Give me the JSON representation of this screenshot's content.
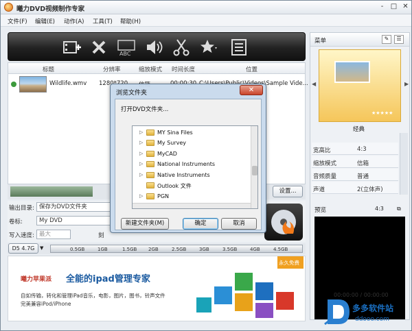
{
  "app": {
    "title": "曦力DVD视频制作专家",
    "window_buttons": [
      "-",
      "□",
      "✕"
    ]
  },
  "menu": [
    "文件(F)",
    "编辑(E)",
    "动作(A)",
    "工具(T)",
    "帮助(H)"
  ],
  "file_list": {
    "columns": [
      "标题",
      "分辨率",
      "缩放模式",
      "时间长度",
      "位置"
    ],
    "rows": [
      {
        "title": "Wildlife.wmv",
        "resolution": "1280*720",
        "zoom": "信箱",
        "duration": "00:00:30",
        "location": "C:\\Users\\Public\\Videos\\Sample Vide..."
      }
    ]
  },
  "settings_button": "设置...",
  "output": {
    "dir_label": "输出目录:",
    "dir_value": "保存为DVD文件夹",
    "volume_label": "卷标:",
    "volume_value": "My DVD",
    "speed_label": "写入速度:",
    "speed_value": "最大",
    "copies_label": "刻"
  },
  "disc": {
    "type": "D5 4.7G",
    "ticks": [
      "0.5GB",
      "1GB",
      "1.5GB",
      "2GB",
      "2.5GB",
      "3GB",
      "3.5GB",
      "4GB",
      "4.5GB"
    ]
  },
  "ad": {
    "brand": "曦力苹果派",
    "headline": "全能的ipad管理专家",
    "line1": "自如传输，转化和管理iPad音乐，电影，图片，图书，铃声文件",
    "line2": "完美兼容iPod/iPhone",
    "badge": "永久免费"
  },
  "right_panel": {
    "menu_title": "菜单",
    "menu_style": "经典",
    "props": [
      {
        "k": "宽高比",
        "v": "4:3"
      },
      {
        "k": "缩放模式",
        "v": "信箱"
      },
      {
        "k": "音频质量",
        "v": "普通"
      },
      {
        "k": "声道",
        "v": "2(立体声)"
      }
    ],
    "preview_title": "预览",
    "preview_ratio": "4:3",
    "time": "00:00:00 / 00:00:00"
  },
  "dialog": {
    "title": "浏览文件夹",
    "close": "✕",
    "prompt": "打开DVD文件夹...",
    "folders": [
      "MY Sina Files",
      "My Survey",
      "MyCAD",
      "National Instruments",
      "Native Instruments",
      "Outlook 文件",
      "PGN"
    ],
    "new_folder": "新建文件夹(M)",
    "ok": "确定",
    "cancel": "取消"
  },
  "watermark": {
    "text": "多多软件站",
    "url": "ddooo.com"
  },
  "colors": {
    "accent": "#e26a10",
    "toolbar": "#222222",
    "dialog": "#c8daec",
    "ad_blue": "#1a5aa0"
  }
}
